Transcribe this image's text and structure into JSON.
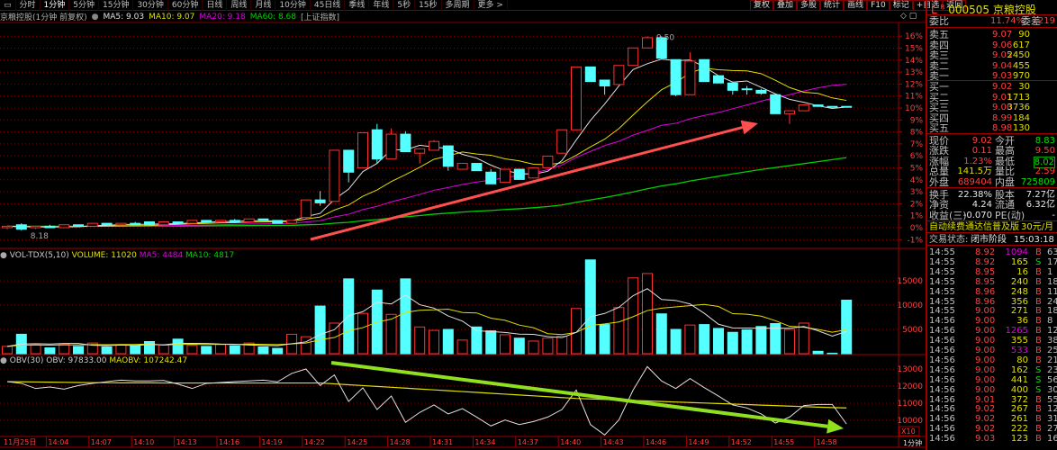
{
  "toolbar": {
    "periods": [
      "分时",
      "1分钟",
      "5分钟",
      "15分钟",
      "30分钟",
      "60分钟",
      "日线",
      "周线",
      "月线",
      "10分钟",
      "45日线",
      "季线",
      "年线",
      "5秒",
      "15秒",
      "多周期",
      "更多 >"
    ],
    "selected": "1分钟",
    "buttons": [
      "复权",
      "叠加",
      "多股",
      "统计",
      "画线",
      "F10",
      "标记",
      "+自选",
      "返回"
    ]
  },
  "chart_title": {
    "name": "京粮控股(1分钟 前复权)",
    "ma5": "MA5: 9.03",
    "ma10": "MA10: 9.07",
    "ma20": "MA20: 9.18",
    "ma60": "MA60: 8.68",
    "index": "[上证指数]",
    "high_label": "9.50",
    "low_label": "8.18"
  },
  "volume_title": {
    "name": "VOL-TDX(5,10)",
    "volume": "VOLUME: 11020",
    "ma5": "MA5: 4484",
    "ma10": "MA10: 4817"
  },
  "obv_title": {
    "name": "OBV(30)",
    "obv": "OBV: 97833.00",
    "maobv": "MAOBV: 107242.47"
  },
  "colors": {
    "up": "#ff3030",
    "down": "#54ffff",
    "ma5": "#e0e0e0",
    "ma10": "#e0e000",
    "ma20": "#e000e0",
    "ma60": "#00d000",
    "grid": "#8b0000",
    "arrow_price": "#ff5050",
    "arrow_obv": "#90e020"
  },
  "chart_data": {
    "type": "candlestick",
    "x": [
      "14:01",
      "14:02",
      "14:03",
      "14:04",
      "14:05",
      "14:06",
      "14:07",
      "14:08",
      "14:09",
      "14:10",
      "14:11",
      "14:12",
      "14:13",
      "14:14",
      "14:15",
      "14:16",
      "14:17",
      "14:18",
      "14:19",
      "14:20",
      "14:21",
      "14:22",
      "14:23",
      "14:24",
      "14:25",
      "14:26",
      "14:27",
      "14:28",
      "14:29",
      "14:30",
      "14:31",
      "14:32",
      "14:33",
      "14:34",
      "14:35",
      "14:36",
      "14:37",
      "14:38",
      "14:39",
      "14:40",
      "14:41",
      "14:42",
      "14:43",
      "14:44",
      "14:45",
      "14:46",
      "14:47",
      "14:48",
      "14:49",
      "14:50",
      "14:51",
      "14:52",
      "14:53",
      "14:54",
      "14:55",
      "14:56",
      "14:57",
      "14:58",
      "14:59",
      "15:00"
    ],
    "ohlc": [
      [
        8.19,
        8.2,
        8.18,
        8.2
      ],
      [
        8.21,
        8.22,
        8.17,
        8.18
      ],
      [
        8.19,
        8.2,
        8.18,
        8.2
      ],
      [
        8.2,
        8.21,
        8.19,
        8.19
      ],
      [
        8.19,
        8.21,
        8.19,
        8.21
      ],
      [
        8.21,
        8.21,
        8.2,
        8.2
      ],
      [
        8.2,
        8.22,
        8.2,
        8.22
      ],
      [
        8.22,
        8.22,
        8.21,
        8.21
      ],
      [
        8.21,
        8.22,
        8.21,
        8.22
      ],
      [
        8.22,
        8.23,
        8.21,
        8.21
      ],
      [
        8.23,
        8.23,
        8.21,
        8.21
      ],
      [
        8.21,
        8.23,
        8.21,
        8.23
      ],
      [
        8.23,
        8.23,
        8.22,
        8.22
      ],
      [
        8.22,
        8.24,
        8.22,
        8.24
      ],
      [
        8.24,
        8.24,
        8.23,
        8.23
      ],
      [
        8.23,
        8.24,
        8.23,
        8.24
      ],
      [
        8.24,
        8.25,
        8.23,
        8.23
      ],
      [
        8.23,
        8.25,
        8.23,
        8.25
      ],
      [
        8.25,
        8.25,
        8.24,
        8.24
      ],
      [
        8.24,
        8.24,
        8.22,
        8.22
      ],
      [
        8.22,
        8.24,
        8.22,
        8.24
      ],
      [
        8.26,
        8.38,
        8.25,
        8.38
      ],
      [
        8.38,
        8.44,
        8.34,
        8.36
      ],
      [
        8.37,
        8.72,
        8.37,
        8.72
      ],
      [
        8.72,
        8.72,
        8.5,
        8.57
      ],
      [
        8.6,
        8.84,
        8.6,
        8.84
      ],
      [
        8.86,
        8.9,
        8.63,
        8.66
      ],
      [
        8.66,
        8.87,
        8.66,
        8.83
      ],
      [
        8.83,
        8.85,
        8.71,
        8.71
      ],
      [
        8.7,
        8.73,
        8.63,
        8.73
      ],
      [
        8.72,
        8.79,
        8.72,
        8.78
      ],
      [
        8.75,
        8.75,
        8.58,
        8.61
      ],
      [
        8.59,
        8.63,
        8.59,
        8.63
      ],
      [
        8.63,
        8.63,
        8.58,
        8.58
      ],
      [
        8.57,
        8.59,
        8.49,
        8.49
      ],
      [
        8.5,
        8.59,
        8.5,
        8.59
      ],
      [
        8.59,
        8.59,
        8.52,
        8.52
      ],
      [
        8.53,
        8.6,
        8.53,
        8.6
      ],
      [
        8.6,
        8.68,
        8.6,
        8.68
      ],
      [
        8.7,
        8.86,
        8.7,
        8.86
      ],
      [
        8.86,
        9.29,
        8.86,
        9.29
      ],
      [
        9.29,
        9.29,
        9.19,
        9.19
      ],
      [
        9.2,
        9.2,
        9.1,
        9.16
      ],
      [
        9.17,
        9.3,
        9.17,
        9.3
      ],
      [
        9.3,
        9.42,
        9.3,
        9.42
      ],
      [
        9.42,
        9.5,
        9.42,
        9.49
      ],
      [
        9.49,
        9.5,
        9.35,
        9.35
      ],
      [
        9.34,
        9.34,
        9.09,
        9.1
      ],
      [
        9.1,
        9.39,
        9.1,
        9.33
      ],
      [
        9.34,
        9.34,
        9.19,
        9.19
      ],
      [
        9.23,
        9.23,
        9.18,
        9.18
      ],
      [
        9.18,
        9.18,
        9.1,
        9.13
      ],
      [
        9.14,
        9.16,
        9.1,
        9.14
      ],
      [
        9.13,
        9.14,
        9.1,
        9.11
      ],
      [
        9.1,
        9.1,
        8.97,
        8.97
      ],
      [
        8.97,
        8.99,
        8.9,
        8.99
      ],
      [
        8.99,
        9.03,
        8.99,
        9.03
      ],
      [
        9.03,
        9.03,
        9.02,
        9.02
      ],
      [
        9.02,
        9.02,
        9.02,
        9.02
      ],
      [
        9.02,
        9.02,
        9.02,
        9.02
      ]
    ],
    "volume": [
      1500,
      4000,
      1800,
      1200,
      2000,
      1500,
      2200,
      1400,
      1800,
      1600,
      2500,
      1800,
      3000,
      1700,
      1500,
      1900,
      1600,
      2200,
      1400,
      1100,
      4000,
      3500,
      9800,
      6300,
      15400,
      8300,
      13100,
      8100,
      15400,
      5500,
      4800,
      5000,
      2800,
      5500,
      4700,
      3900,
      3200,
      2600,
      3200,
      3600,
      9300,
      19300,
      6000,
      9500,
      15600,
      16500,
      8200,
      5000,
      5900,
      6000,
      5200,
      4400,
      4900,
      5600,
      6200,
      5000,
      6300,
      500,
      100,
      11020
    ],
    "obv_x10": [
      12263,
      12160,
      11860,
      11950,
      11820,
      12035,
      12160,
      12260,
      12350,
      12300,
      12300,
      12330,
      12120,
      11860,
      12160,
      12210,
      12260,
      12300,
      12350,
      12250,
      12740,
      13000,
      12035,
      12650,
      11100,
      11900,
      10630,
      11420,
      9880,
      10460,
      10900,
      10370,
      10680,
      10190,
      9670,
      10020,
      9750,
      9930,
      10190,
      10630,
      11770,
      9750,
      9140,
      10020,
      11770,
      13140,
      12300,
      11860,
      12440,
      11910,
      11420,
      10900,
      10720,
      10370,
      9840,
      10190,
      10860,
      10930,
      10930,
      9783
    ],
    "maobv_x10": [
      12260,
      12250,
      12240,
      12230,
      12220,
      12210,
      12200,
      12200,
      12190,
      12190,
      12190,
      12180,
      12180,
      12180,
      12180,
      12180,
      12180,
      12180,
      12180,
      12180,
      12180,
      12180,
      12180,
      12130,
      12080,
      12030,
      11980,
      11930,
      11880,
      11830,
      11780,
      11730,
      11680,
      11630,
      11580,
      11530,
      11480,
      11430,
      11380,
      11330,
      11280,
      11250,
      11220,
      11190,
      11160,
      11130,
      11100,
      11070,
      11040,
      11010,
      10980,
      10950,
      10920,
      10890,
      10860,
      10830,
      10800,
      10770,
      10745,
      10724
    ],
    "price_axis_pct": [
      "16%",
      "15%",
      "14%",
      "13%",
      "12%",
      "11%",
      "10%",
      "9%",
      "8%",
      "7%",
      "6%",
      "5%",
      "4%",
      "3%",
      "2%",
      "1%",
      "0%",
      "-1%"
    ],
    "volume_axis": [
      "15000",
      "10000",
      "5000"
    ],
    "obv_axis": [
      "13000",
      "12000",
      "11000",
      "10000"
    ],
    "obv_scale_label": "X10",
    "x_tick_labels": [
      "11月25日",
      "14:04",
      "14:07",
      "14:10",
      "14:13",
      "14:16",
      "14:19",
      "14:22",
      "14:25",
      "14:28",
      "14:31",
      "14:34",
      "14:37",
      "14:40",
      "14:43",
      "14:46",
      "14:49",
      "14:52",
      "14:55",
      "14:58"
    ],
    "period_label": "1分钟"
  },
  "quote": {
    "market": "L",
    "flag": "R",
    "code_name": "000505 京粮控股",
    "weibi_label": "委比",
    "weibi": "11.74%",
    "weicha_label": "委差",
    "weicha": "1219",
    "sells": [
      {
        "label": "卖五",
        "price": "9.07",
        "vol": "90"
      },
      {
        "label": "卖四",
        "price": "9.06",
        "vol": "617"
      },
      {
        "label": "卖三",
        "price": "9.05",
        "vol": "2450"
      },
      {
        "label": "卖二",
        "price": "9.04",
        "vol": "455"
      },
      {
        "label": "卖一",
        "price": "9.03",
        "vol": "970"
      }
    ],
    "buys": [
      {
        "label": "买一",
        "price": "9.02",
        "vol": "30"
      },
      {
        "label": "买二",
        "price": "9.01",
        "vol": "1713"
      },
      {
        "label": "买三",
        "price": "9.00",
        "vol": "3736"
      },
      {
        "label": "买四",
        "price": "8.99",
        "vol": "184"
      },
      {
        "label": "买五",
        "price": "8.98",
        "vol": "130"
      }
    ],
    "stats": [
      {
        "l1": "现价",
        "v1": "9.02",
        "c1": "red",
        "l2": "今开",
        "v2": "8.83",
        "c2": "grn"
      },
      {
        "l1": "涨跌",
        "v1": "0.11",
        "c1": "red",
        "l2": "最高",
        "v2": "9.50",
        "c2": "red"
      },
      {
        "l1": "涨幅",
        "v1": "1.23%",
        "c1": "red",
        "l2": "最低",
        "v2": "8.02",
        "c2": "grn"
      },
      {
        "l1": "总量",
        "v1": "141.5万",
        "c1": "yel",
        "l2": "量比",
        "v2": "2.59",
        "c2": "red"
      },
      {
        "l1": "外盘",
        "v1": "689404",
        "c1": "red",
        "l2": "内盘",
        "v2": "725809",
        "c2": "grn"
      }
    ],
    "fund": [
      {
        "l1": "换手",
        "v1": "22.38%",
        "l2": "股本",
        "v2": "7.27亿"
      },
      {
        "l1": "净资",
        "v1": "4.24",
        "l2": "流通",
        "v2": "6.32亿"
      },
      {
        "l1": "收益(三)",
        "v1": "-0.070",
        "l2": "PE(动)",
        "v2": "-"
      }
    ],
    "promo": "自动续费通达信普及版",
    "promo_price": "30元/月",
    "status_label": "交易状态:",
    "status": "闭市阶段",
    "status_time": "15:03:18"
  },
  "trades": [
    {
      "t": "14:55",
      "p": "8.92",
      "v": "1094",
      "big": true,
      "bs": "B",
      "n": "63"
    },
    {
      "t": "14:55",
      "p": "8.92",
      "v": "165",
      "big": false,
      "bs": "S",
      "n": "17"
    },
    {
      "t": "14:55",
      "p": "8.95",
      "v": "16",
      "big": false,
      "bs": "B",
      "n": "1"
    },
    {
      "t": "14:55",
      "p": "8.95",
      "v": "240",
      "big": false,
      "bs": "B",
      "n": "18"
    },
    {
      "t": "14:55",
      "p": "8.96",
      "v": "248",
      "big": false,
      "bs": "B",
      "n": "11"
    },
    {
      "t": "14:55",
      "p": "8.96",
      "v": "356",
      "big": false,
      "bs": "B",
      "n": "24"
    },
    {
      "t": "14:55",
      "p": "9.00",
      "v": "271",
      "big": false,
      "bs": "B",
      "n": "18"
    },
    {
      "t": "14:56",
      "p": "9.00",
      "v": "36",
      "big": false,
      "bs": "B",
      "n": "8"
    },
    {
      "t": "14:56",
      "p": "9.00",
      "v": "1265",
      "big": true,
      "bs": "B",
      "n": "121"
    },
    {
      "t": "14:56",
      "p": "9.00",
      "v": "355",
      "big": false,
      "bs": "B",
      "n": "38"
    },
    {
      "t": "14:56",
      "p": "9.00",
      "v": "533",
      "big": true,
      "bs": "B",
      "n": "25"
    },
    {
      "t": "14:56",
      "p": "9.00",
      "v": "80",
      "big": false,
      "bs": "B",
      "n": "21"
    },
    {
      "t": "14:56",
      "p": "9.00",
      "v": "162",
      "big": false,
      "bs": "S",
      "n": "23"
    },
    {
      "t": "14:56",
      "p": "9.00",
      "v": "441",
      "big": false,
      "bs": "S",
      "n": "56"
    },
    {
      "t": "14:56",
      "p": "9.00",
      "v": "400",
      "big": false,
      "bs": "S",
      "n": "30"
    },
    {
      "t": "14:56",
      "p": "9.01",
      "v": "372",
      "big": false,
      "bs": "B",
      "n": "55"
    },
    {
      "t": "14:56",
      "p": "9.02",
      "v": "267",
      "big": false,
      "bs": "B",
      "n": "12"
    },
    {
      "t": "14:56",
      "p": "9.02",
      "v": "261",
      "big": false,
      "bs": "B",
      "n": "31"
    },
    {
      "t": "14:56",
      "p": "9.02",
      "v": "222",
      "big": false,
      "bs": "B",
      "n": "27"
    },
    {
      "t": "14:56",
      "p": "9.03",
      "v": "123",
      "big": false,
      "bs": "B",
      "n": "16"
    }
  ]
}
